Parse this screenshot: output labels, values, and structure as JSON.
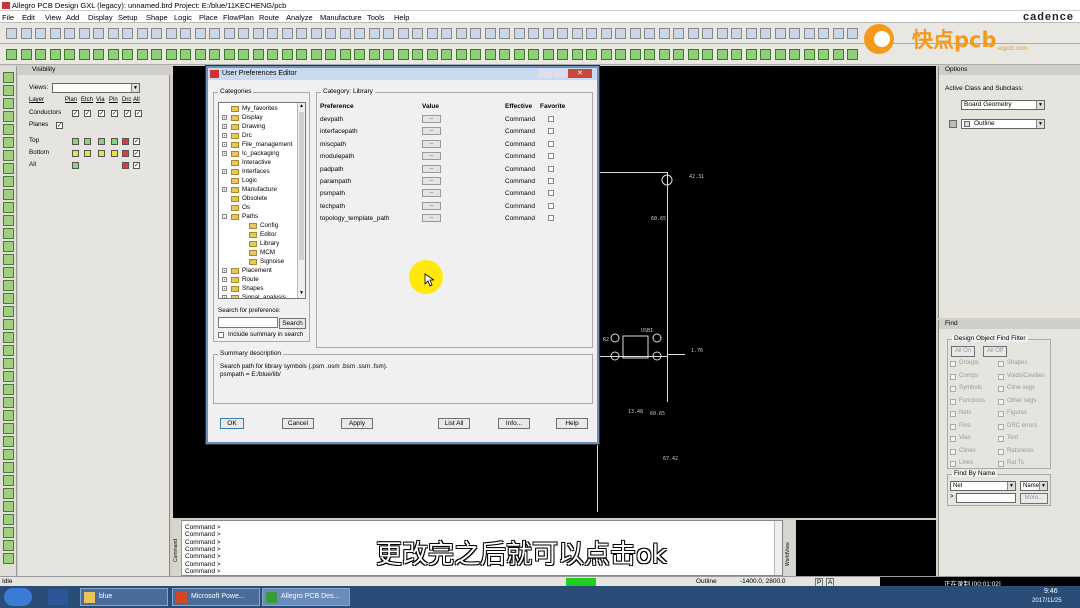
{
  "window": {
    "title": "Allegro PCB Design GXL (legacy): unnamed.brd  Project: E:/blue/11KECHENG/pcb",
    "brand": "cadence"
  },
  "menu": [
    "File",
    "Edit",
    "View",
    "Add",
    "Display",
    "Setup",
    "Shape",
    "Logic",
    "Place",
    "FlowPlan",
    "Route",
    "Analyze",
    "Manufacture",
    "Tools",
    "Help"
  ],
  "logo": {
    "text": "快点pcb",
    "sub": "eqpcb.com"
  },
  "visibility": {
    "title": "Visibility",
    "views_label": "Views:",
    "columns": [
      "Layer",
      "Plan",
      "Etch",
      "Via",
      "Pin",
      "Drc",
      "All"
    ],
    "rows": [
      "Conductors",
      "Planes",
      "Top",
      "Bottom",
      "All"
    ]
  },
  "options": {
    "title": "Options",
    "active_label": "Active Class and Subclass:",
    "class_value": "Board Geometry",
    "subclass_value": "Outline"
  },
  "find": {
    "title": "Find",
    "group_label": "Design Object Find Filter",
    "all_on": "All On",
    "all_off": "All Off",
    "items_left": [
      "Groups",
      "Comps",
      "Symbols",
      "Functions",
      "Nets",
      "Pins",
      "Vias",
      "Clines",
      "Lines"
    ],
    "items_right": [
      "Shapes",
      "Voids/Cavities",
      "Cline segs",
      "Other segs",
      "Figures",
      "DRC errors",
      "Text",
      "Ratsnests",
      "Rat Ts"
    ],
    "by_name_label": "Find By Name",
    "by_name_type": "Net",
    "by_name_mode": "Name",
    "more": "More..."
  },
  "dialog": {
    "title": "User Preferences Editor",
    "categories_label": "Categories",
    "category_caption": "Category:  Library",
    "tree": [
      {
        "label": "My_favorites",
        "depth": 0,
        "plus": false
      },
      {
        "label": "Display",
        "depth": 0,
        "plus": true
      },
      {
        "label": "Drawing",
        "depth": 0,
        "plus": true
      },
      {
        "label": "Drc",
        "depth": 0,
        "plus": true
      },
      {
        "label": "File_management",
        "depth": 0,
        "plus": true
      },
      {
        "label": "Ic_packaging",
        "depth": 0,
        "plus": true
      },
      {
        "label": "Interactive",
        "depth": 0,
        "plus": false
      },
      {
        "label": "Interfaces",
        "depth": 0,
        "plus": true
      },
      {
        "label": "Logic",
        "depth": 0,
        "plus": false
      },
      {
        "label": "Manufacture",
        "depth": 0,
        "plus": true
      },
      {
        "label": "Obsolete",
        "depth": 0,
        "plus": false
      },
      {
        "label": "Os",
        "depth": 0,
        "plus": false
      },
      {
        "label": "Paths",
        "depth": 0,
        "plus": "-"
      },
      {
        "label": "Config",
        "depth": 1,
        "plus": false
      },
      {
        "label": "Editor",
        "depth": 1,
        "plus": false
      },
      {
        "label": "Library",
        "depth": 1,
        "plus": false
      },
      {
        "label": "MCM",
        "depth": 1,
        "plus": false
      },
      {
        "label": "Signoise",
        "depth": 1,
        "plus": false
      },
      {
        "label": "Placement",
        "depth": 0,
        "plus": true
      },
      {
        "label": "Route",
        "depth": 0,
        "plus": true
      },
      {
        "label": "Shapes",
        "depth": 0,
        "plus": true
      },
      {
        "label": "Signal_analysis",
        "depth": 0,
        "plus": true
      }
    ],
    "search_label": "Search for preference:",
    "search_button": "Search",
    "include_summary": "Include summary in search",
    "headers": {
      "preference": "Preference",
      "value": "Value",
      "effective": "Effective",
      "favorite": "Favorite"
    },
    "prefs": [
      {
        "name": "devpath",
        "effective": "Command"
      },
      {
        "name": "interfacepath",
        "effective": "Command"
      },
      {
        "name": "miscpath",
        "effective": "Command"
      },
      {
        "name": "modulepath",
        "effective": "Command"
      },
      {
        "name": "padpath",
        "effective": "Command"
      },
      {
        "name": "parampath",
        "effective": "Command"
      },
      {
        "name": "psmpath",
        "effective": "Command"
      },
      {
        "name": "techpath",
        "effective": "Command"
      },
      {
        "name": "topology_template_path",
        "effective": "Command"
      }
    ],
    "value_btn": "...",
    "summary_label": "Summary description",
    "summary_lines": [
      "Search path for library symbols (.psm .osm .bsm .ssm .fsm).",
      "psmpath = E:/blue/lib/"
    ],
    "buttons": {
      "ok": "OK",
      "cancel": "Cancel",
      "apply": "Apply",
      "list_all": "List All",
      "info": "Info...",
      "help": "Help"
    }
  },
  "canvas_labels": [
    "42.31",
    "60.65",
    "USB1",
    "1.76",
    "13.48",
    "60.65",
    "67.42",
    "R2"
  ],
  "command_lines": [
    "Command >",
    "Command >",
    "Command >",
    "Command >",
    "Command >",
    "Command >",
    "Command >"
  ],
  "command_side": "Command",
  "worldview_label": "WorldView",
  "subtitle": "更改完之后就可以点击ok",
  "status": {
    "mode": "Idle",
    "subclass": "Outline",
    "coords": "-1400.0, 2800.0",
    "p": "P",
    "a": "A",
    "recording": "正在录制 [00:01:02]"
  },
  "taskbar": {
    "tasks": [
      "blue",
      "Microsoft Powe...",
      "Allegro PCB Des..."
    ],
    "time": "9:46",
    "date": "2017/11/25"
  },
  "colors": {
    "accent": "#c9daf0",
    "canvas": "#000000",
    "cursor": "#ffe800"
  }
}
